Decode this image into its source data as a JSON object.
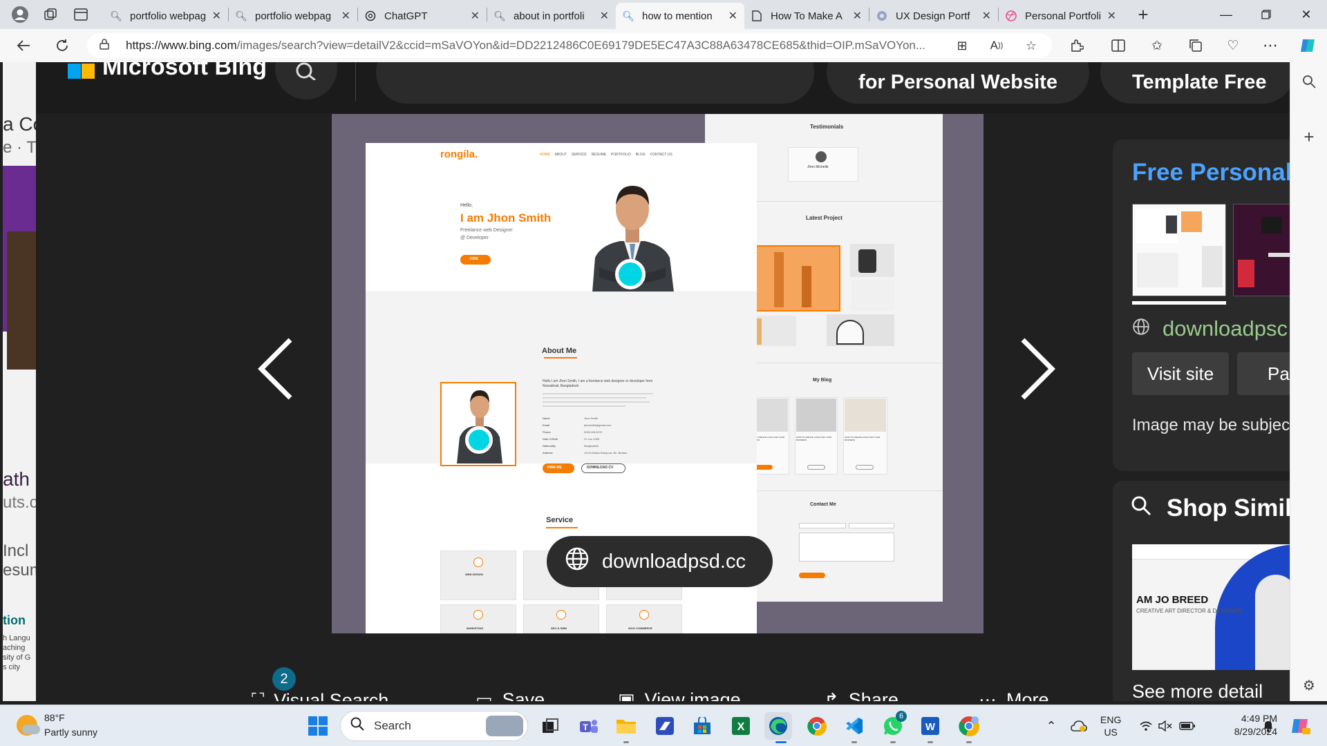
{
  "browser": {
    "tabs": [
      {
        "label": "portfolio webpag",
        "icon": "search-icon",
        "active": false
      },
      {
        "label": "portfolio webpag",
        "icon": "search-icon",
        "active": false
      },
      {
        "label": "ChatGPT",
        "icon": "chatgpt-icon",
        "active": false
      },
      {
        "label": "about in portfoli",
        "icon": "search-icon",
        "active": false
      },
      {
        "label": "how to mention",
        "icon": "search-icon",
        "active": true
      },
      {
        "label": "How To Make A",
        "icon": "document-icon",
        "active": false
      },
      {
        "label": "UX Design Portf",
        "icon": "site-icon",
        "active": false
      },
      {
        "label": "Personal Portfoli",
        "icon": "dribbble-icon",
        "active": false
      }
    ],
    "url_host": "https://www.bing.com",
    "url_path": "/images/search?view=detailV2&ccid=mSaVOYon&id=DD2212486C0E69179DE5EC47A3C88A63478CE685&thid=OIP.mSaVOYon..."
  },
  "bing": {
    "brand": "Microsoft Bing",
    "related_pills": [
      "",
      "for Personal Website",
      "Template Free"
    ],
    "source_chip": "downloadpsd.cc",
    "actions": [
      {
        "label": "Visual Search",
        "icon": "visual-search-icon"
      },
      {
        "label": "Save",
        "icon": "save-icon"
      },
      {
        "label": "View image",
        "icon": "view-image-icon"
      },
      {
        "label": "Share",
        "icon": "share-icon"
      },
      {
        "label": "More",
        "icon": "more-icon"
      }
    ],
    "visual_search_badge": "2",
    "panel": {
      "title": "Free Personal",
      "site": "downloadpsc",
      "visit_button": "Visit site",
      "page_button": "Pag",
      "note": "Image may be subjec",
      "shop_title": "Shop Simil",
      "shop_card_name": "AM JO BREED",
      "shop_card_sub": "CREATIVE ART DIRECTOR & DESIGNER",
      "more_details": "See more detail"
    }
  },
  "mockup": {
    "logo": "rongila.",
    "nav": [
      "HOME",
      "ABOUT",
      "SERVICE",
      "RESUME",
      "PORTFOLIO",
      "BLOG",
      "CONTACT US"
    ],
    "hello": "Hello,",
    "name": "I am Jhon Smith",
    "role1": "Freelance web Designer",
    "role2": "@ Developer",
    "hire": "HIRE",
    "about_title": "About Me",
    "about_text": "Hello I am Jhon Smith, I am a freelance web designer or developer from Nowakhali, Bangladesh.",
    "info_labels": [
      "Name",
      "Email",
      "Phone",
      "Date of Birth",
      "Nationality",
      "Address"
    ],
    "info_values": [
      "Jhon Smith",
      "jhonsmith@gmail.com",
      "0000-0012478",
      "21 Jun 1995",
      "Bangladesh",
      "121/3 Dhaka Rampura, Bn. Brobau"
    ],
    "hire_me": "HIRE ME",
    "download_cv": "DOWNLOAD CV",
    "service_title": "Service",
    "services": [
      "WEB DESIGN",
      "",
      "",
      "MARKETING",
      "SEO & SMM",
      "WOO COMMERCE"
    ],
    "testimonials": "Testimonials",
    "testi_name": "Jhon Michelle",
    "latest_project": "Latest Project",
    "my_blog": "My Blog",
    "blog_caption": "HOW TO CREATE LOGO FOR YOUR BUSINESS",
    "contact_title": "Contact Me"
  },
  "underlying": {
    "snips": [
      "a Co",
      "e · T",
      "ath",
      "uts.c",
      "Incl",
      "esum",
      "tion",
      "h Langu",
      "aching",
      "sity of G",
      "s city"
    ]
  },
  "taskbar": {
    "temp": "88°F",
    "weather": "Partly sunny",
    "search_placeholder": "Search",
    "lang1": "ENG",
    "lang2": "US",
    "time": "4:49 PM",
    "date": "8/29/2024",
    "whatsapp_badge": "6"
  }
}
